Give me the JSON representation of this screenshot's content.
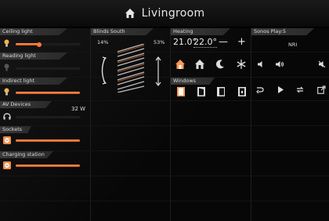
{
  "header": {
    "title": "Livingroom",
    "icon": "home-icon"
  },
  "lights": [
    {
      "label": "Ceiling light",
      "level": 0.35,
      "on": true
    },
    {
      "label": "Reading light",
      "level": 0.0,
      "on": false
    },
    {
      "label": "Indirect light",
      "level": 1.0,
      "on": true
    }
  ],
  "av": {
    "label": "AV Devices",
    "power": "32 W"
  },
  "sockets": {
    "label": "Sockets",
    "level": 1.0
  },
  "charging": {
    "label": "Charging station",
    "level": 1.0
  },
  "blinds": {
    "label": "Blinds South",
    "left_pct": "14%",
    "right_pct": "53%"
  },
  "heating": {
    "label": "Heating",
    "current": "21.0°",
    "target": "22.0°",
    "minus": "—",
    "plus": "+",
    "modes": [
      "comfort-home-icon",
      "standby-home-icon",
      "night-icon",
      "frost-icon"
    ]
  },
  "windows": {
    "label": "Windows"
  },
  "sonos": {
    "label": "Sonos Play:5",
    "station": "NRI",
    "controls": [
      "volume-down-icon",
      "volume-up-icon",
      "mute-icon",
      "shuffle-icon",
      "play-icon",
      "repeat-icon",
      "open-icon"
    ]
  },
  "colors": {
    "accent": "#ff7a3a",
    "tab": "#333333",
    "bg": "#070707"
  }
}
